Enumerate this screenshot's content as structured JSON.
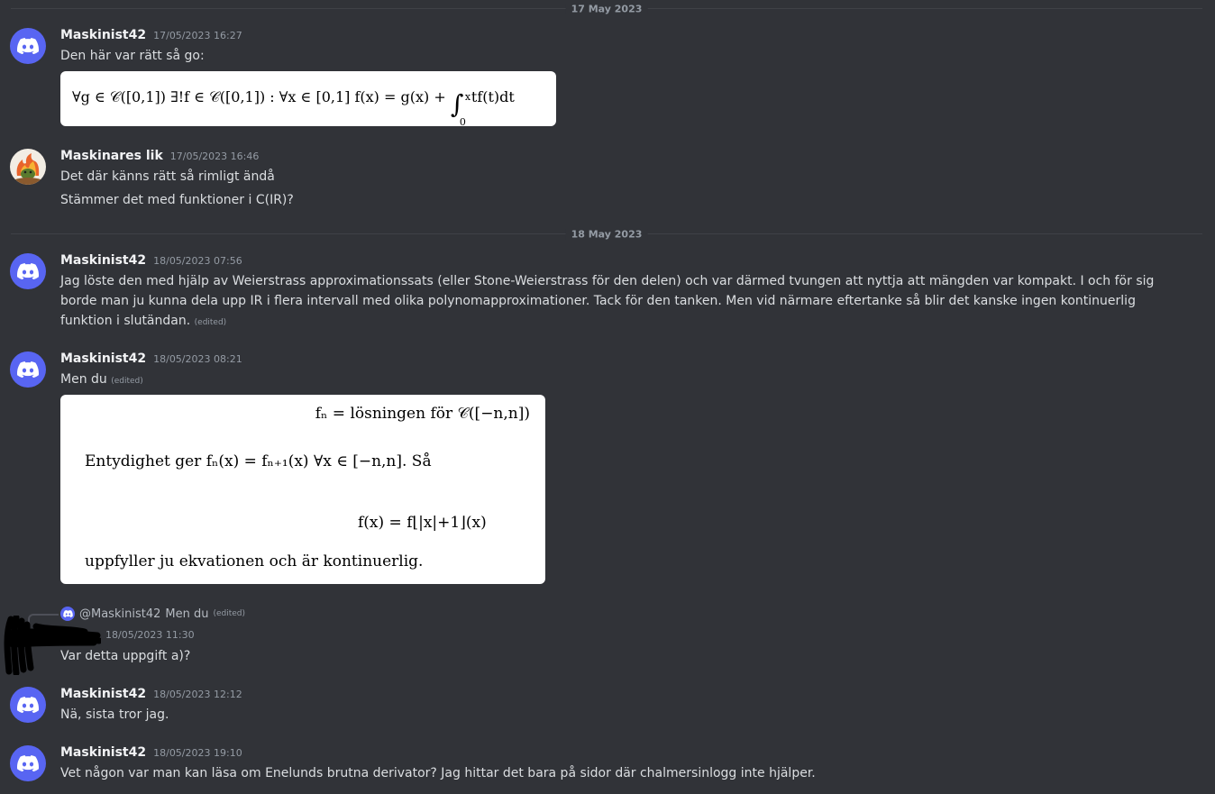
{
  "dividers": [
    "17 May 2023",
    "18 May 2023"
  ],
  "messages": [
    {
      "username": "Maskinist42",
      "timestamp": "17/05/2023 16:27",
      "text": "Den här var rätt så go:",
      "math": {
        "part1": "∀g ∈ 𝒞([0,1])   ∃!f ∈ 𝒞([0,1]) : ∀x ∈ [0,1]   f(x) = g(x) + ",
        "integral": "∫",
        "upper": "x",
        "lower": "0",
        "part2": " tf(t)dt"
      }
    },
    {
      "username": "Maskinares lik",
      "timestamp": "17/05/2023 16:46",
      "lines": [
        "Det där känns rätt så rimligt ändå",
        "Stämmer det med funktioner i C(IR)?"
      ]
    },
    {
      "username": "Maskinist42",
      "timestamp": "18/05/2023 07:56",
      "text": "Jag löste den med hjälp av Weierstrass approximationssats (eller Stone-Weierstrass för den delen) och var därmed tvungen att nyttja att mängden var kompakt. I och för sig borde man ju kunna dela upp IR i flera intervall med olika polynomapproximationer. Tack för den tanken. Men vid närmare eftertanke så blir det kanske ingen kontinuerlig funktion i slutändan.",
      "edited": "(edited)"
    },
    {
      "username": "Maskinist42",
      "timestamp": "18/05/2023 08:21",
      "text": "Men du",
      "edited": "(edited)",
      "math": {
        "line1": "fₙ = lösningen för 𝒞([−n,n])",
        "line2": "Entydighet ger fₙ(x) = fₙ₊₁(x)   ∀x ∈ [−n,n]. Så",
        "line3": "f(x) = f⌊|x|+1⌋(x)",
        "line4": "uppfyller ju ekvationen och är kontinuerlig."
      }
    },
    {
      "reply_to": "@Maskinist42",
      "reply_text": "Men du",
      "reply_edited": "(edited)",
      "timestamp": "18/05/2023 11:30",
      "text": "Var detta uppgift a)?"
    },
    {
      "username": "Maskinist42",
      "timestamp": "18/05/2023 12:12",
      "text": "Nä, sista tror jag."
    },
    {
      "username": "Maskinist42",
      "timestamp": "18/05/2023 19:10",
      "text": "Vet någon var man kan läsa om Enelunds brutna derivator? Jag hittar det bara på sidor där chalmersinlogg inte hjälper."
    }
  ],
  "colors": {
    "background": "#313338",
    "blurple": "#5865f2",
    "username": "#f2f3f5",
    "muted": "#949ba4"
  },
  "icons": {
    "discord_avatar": "discord-logo-icon",
    "fire_avatar": "fire-creature-avatar"
  }
}
